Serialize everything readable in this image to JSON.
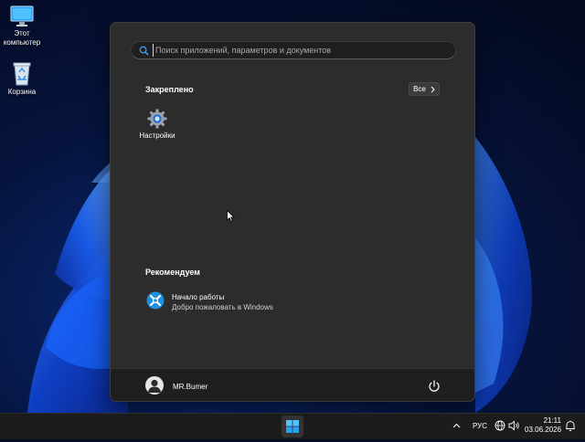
{
  "desktop": {
    "icons": [
      {
        "label": "Этот\nкомпьютер",
        "icon": "monitor-icon"
      },
      {
        "label": "Корзина",
        "icon": "recycle-bin-icon"
      }
    ]
  },
  "start_menu": {
    "search": {
      "placeholder": "Поиск приложений, параметров и документов",
      "value": ""
    },
    "pinned": {
      "title": "Закреплено",
      "all_label": "Все",
      "apps": [
        {
          "label": "Настройки",
          "icon": "settings-gear-icon"
        }
      ]
    },
    "recommended": {
      "title": "Рекомендуем",
      "items": [
        {
          "title": "Начало работы",
          "subtitle": "Добро пожаловать в Windows",
          "icon": "get-started-icon"
        }
      ]
    },
    "user": {
      "name": "MR.Bumer"
    },
    "accent_color": "#0067c0"
  },
  "taskbar": {
    "language": "РУС",
    "time": "21:11",
    "date": "03.06.2026"
  }
}
